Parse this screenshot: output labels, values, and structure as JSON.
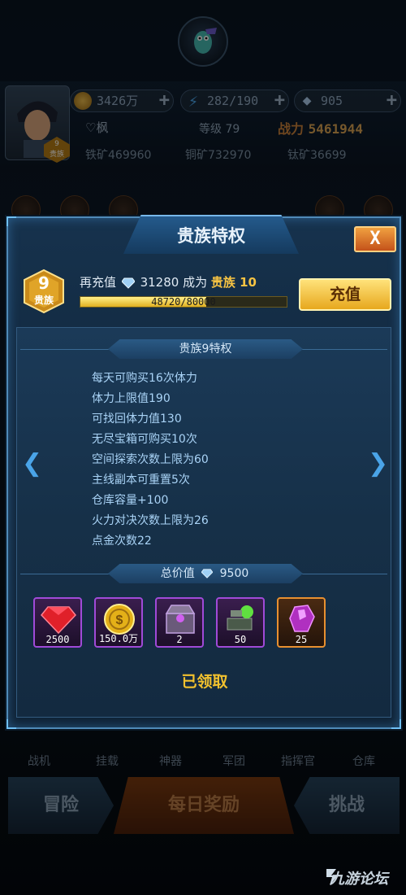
{
  "resources": {
    "gold": "3426万",
    "energy": "282/190",
    "diamonds": "905",
    "plus": "+"
  },
  "player": {
    "name": "♡枫",
    "level_label": "等级",
    "level_value": "79",
    "power_label": "战力",
    "power_value": "5461944",
    "vip_level": "9",
    "vip_label": "贵族",
    "iron_ore": "铁矿469960",
    "copper_ore": "铜矿732970",
    "titanium_ore": "钛矿36699"
  },
  "modal": {
    "title": "贵族特权",
    "close": "X",
    "vip_badge_level": "9",
    "vip_badge_label": "贵族",
    "recharge_prefix": "再充值",
    "recharge_amount": "31280",
    "recharge_suffix": "成为",
    "next_vip": "贵族 10",
    "progress_text": "48720/80000",
    "progress_fraction": 0.609,
    "recharge_button": "充值",
    "section_title": "贵族9特权",
    "perks": [
      "每天可购买16次体力",
      "体力上限值190",
      "可找回体力值130",
      "无尽宝箱可购买10次",
      "空间探索次数上限为60",
      "主线副本可重置5次",
      "仓库容量+100",
      "火力对决次数上限为26",
      "点金次数22"
    ],
    "total_label": "总价值",
    "total_value": "9500",
    "rewards": [
      {
        "icon": "red-gem-icon",
        "qty": "2500",
        "frame": "purple"
      },
      {
        "icon": "gold-coin-icon",
        "qty": "150.0万",
        "frame": "purple"
      },
      {
        "icon": "treasure-chest-icon",
        "qty": "2",
        "frame": "purple"
      },
      {
        "icon": "green-parts-icon",
        "qty": "50",
        "frame": "purple"
      },
      {
        "icon": "purple-crystal-icon",
        "qty": "25",
        "frame": "orange"
      }
    ],
    "status": "已领取"
  },
  "bottom_nav": {
    "tabs": [
      "战机",
      "挂载",
      "神器",
      "军团",
      "指挥官",
      "仓库"
    ],
    "adventure": "冒险",
    "daily_reward": "每日奖励",
    "challenge": "挑战"
  },
  "watermark": "九游论坛",
  "colors": {
    "accent_gold": "#f6c343",
    "perk_text": "#a9d3f6",
    "panel_border": "#4f8ab8",
    "close_orange": "#e07a2a"
  }
}
